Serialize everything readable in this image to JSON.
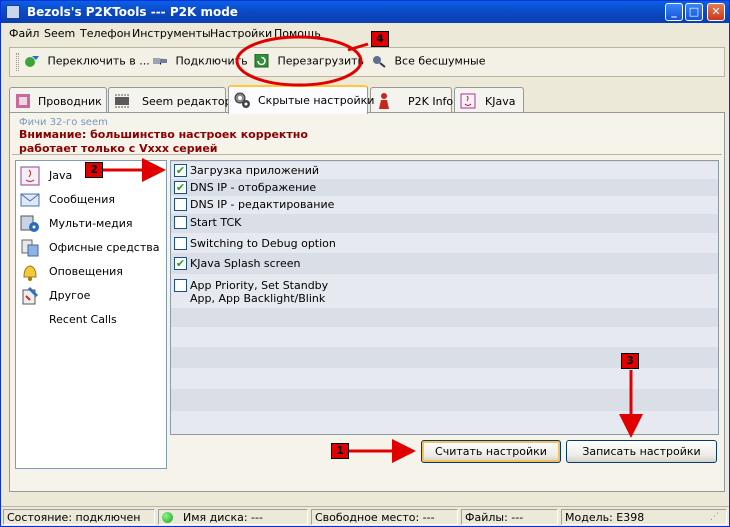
{
  "window": {
    "title": "Bezols's P2KTools --- P2K mode"
  },
  "menu": [
    "Файл",
    "Seem",
    "Телефон",
    "Инструменты",
    "Настройки",
    "Помощь"
  ],
  "toolbar": {
    "switch_label": "Переключить в ...",
    "connect_label": "Подключить",
    "restart_label": "Перезагрузить",
    "silent_label": "Все бесшумные"
  },
  "tabs": [
    {
      "label": "Проводник",
      "icon": "explorer-icon"
    },
    {
      "label": "Seem редактор",
      "icon": "chip-icon"
    },
    {
      "label": "Скрытые настройки",
      "icon": "gears-icon",
      "active": true
    },
    {
      "label": "P2K Info",
      "icon": "person-icon"
    },
    {
      "label": "KJava",
      "icon": "java-icon"
    }
  ],
  "page": {
    "feature_label": "Фичи 32-го seem",
    "warning_line1": "Внимание: большинство настроек корректно",
    "warning_line2": "работает только с Vxxx серией"
  },
  "categories": [
    {
      "label": "Java",
      "icon": "java-app-icon"
    },
    {
      "label": "Сообщения",
      "icon": "envelope-icon"
    },
    {
      "label": "Мульти-медия",
      "icon": "multimedia-icon"
    },
    {
      "label": "Офисные средства",
      "icon": "office-icon"
    },
    {
      "label": "Оповещения",
      "icon": "bell-icon"
    },
    {
      "label": "Другое",
      "icon": "tools-icon"
    },
    {
      "label": "Recent Calls",
      "icon": ""
    }
  ],
  "options": [
    {
      "label": "Загрузка приложений",
      "checked": true
    },
    {
      "label": "DNS IP - отображение",
      "checked": true
    },
    {
      "label": "DNS IP - редактирование",
      "checked": false
    },
    {
      "label": "Start TCK",
      "checked": false
    },
    {
      "label": "Switching to Debug option",
      "checked": false
    },
    {
      "label": "KJava Splash screen",
      "checked": true
    },
    {
      "label_line1": "App Priority, Set Standby",
      "label_line2": "App, App Backlight/Blink",
      "checked": false
    }
  ],
  "buttons": {
    "read_label": "Считать настройки",
    "write_label": "Записать настройки"
  },
  "status": {
    "state": "Состояние: подключен",
    "disk": "Имя диска: ---",
    "free": "Свободное место: ---",
    "files": "Файлы: ---",
    "model": "Модель: E398"
  },
  "annotations": [
    "1",
    "2",
    "3",
    "4"
  ],
  "colors": {
    "annotation": "#e10000",
    "warning": "#8b0000",
    "connected": "#1aa21a"
  }
}
